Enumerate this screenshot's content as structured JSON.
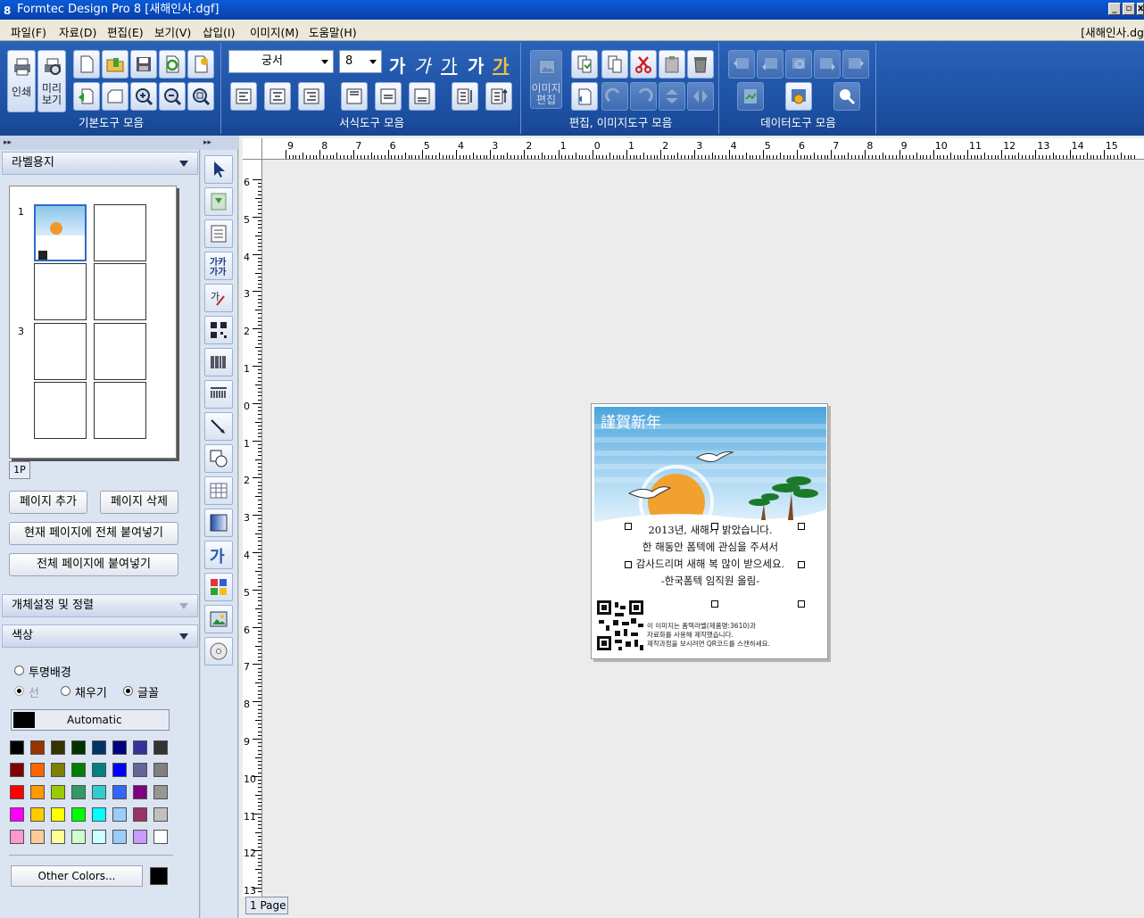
{
  "window": {
    "title": "Formtec Design Pro 8 [새해인사.dgf]",
    "doc_name": "[새해인사.dg"
  },
  "menu": [
    "파일(F)",
    "자료(D)",
    "편집(E)",
    "보기(V)",
    "삽입(I)",
    "이미지(M)",
    "도움말(H)"
  ],
  "toolbar": {
    "groups": [
      "기본도구 모음",
      "서식도구 모음",
      "편집, 이미지도구 모음",
      "데이터도구 모음"
    ],
    "print_label": "인쇄",
    "preview_label": "미리\n보기",
    "image_edit_label": "이미지\n편집",
    "font_name": "궁서",
    "font_size": "8",
    "style_glyphs": [
      "가",
      "가",
      "가",
      "가",
      "가"
    ]
  },
  "left_panel": {
    "label_paper": "라벨용지",
    "page_numbers": [
      "1",
      "3"
    ],
    "page_tab": "1P",
    "buttons": [
      "페이지 추가",
      "페이지 삭제",
      "현재 페이지에 전체 붙여넣기",
      "전체 페이지에 붙여넣기"
    ],
    "object_settings": "개체설정 및 정렬",
    "color_section": "색상",
    "transparent_bg": "투명배경",
    "line": "선",
    "fill": "채우기",
    "text": "글꼴",
    "automatic": "Automatic",
    "other_colors": "Other Colors...",
    "palette": [
      "#000000",
      "#993300",
      "#333300",
      "#003300",
      "#003366",
      "#000080",
      "#333399",
      "#333333",
      "#800000",
      "#ff6600",
      "#808000",
      "#008000",
      "#008080",
      "#0000ff",
      "#666699",
      "#808080",
      "#ff0000",
      "#ff9900",
      "#99cc00",
      "#339966",
      "#33cccc",
      "#3366ff",
      "#800080",
      "#969696",
      "#ff00ff",
      "#ffcc00",
      "#ffff00",
      "#00ff00",
      "#00ffff",
      "#99ccff",
      "#993366",
      "#c0c0c0",
      "#ff99cc",
      "#ffcc99",
      "#ffff99",
      "#ccffcc",
      "#ccffff",
      "#99ccff",
      "#cc99ff",
      "#ffffff"
    ]
  },
  "ruler": {
    "h": [
      "9",
      "8",
      "7",
      "6",
      "5",
      "4",
      "3",
      "2",
      "1",
      "0",
      "1",
      "2",
      "3",
      "4",
      "5",
      "6",
      "7",
      "8",
      "9",
      "10",
      "11",
      "12",
      "13",
      "14",
      "15"
    ],
    "v": [
      "6",
      "5",
      "4",
      "3",
      "2",
      "1",
      "0",
      "1",
      "2",
      "3",
      "4",
      "5",
      "6",
      "7",
      "8",
      "9",
      "10",
      "11",
      "12",
      "13"
    ]
  },
  "page_tab": "1 Page",
  "card": {
    "title": "謹賀新年",
    "lines": [
      "2013년, 새해가 밝았습니다.",
      "한 해동안 폼텍에 관심을 주셔서",
      "감사드리며 새해 복 많이 받으세요.",
      "-한국폼텍 임직원 올림-"
    ],
    "small": [
      "이 이미지는 폼텍라벨(제품명:3610)과",
      "자료화를 사용해 제작했습니다.",
      "제작과정을 보시려면 QR코드를 스캔하세요."
    ]
  }
}
